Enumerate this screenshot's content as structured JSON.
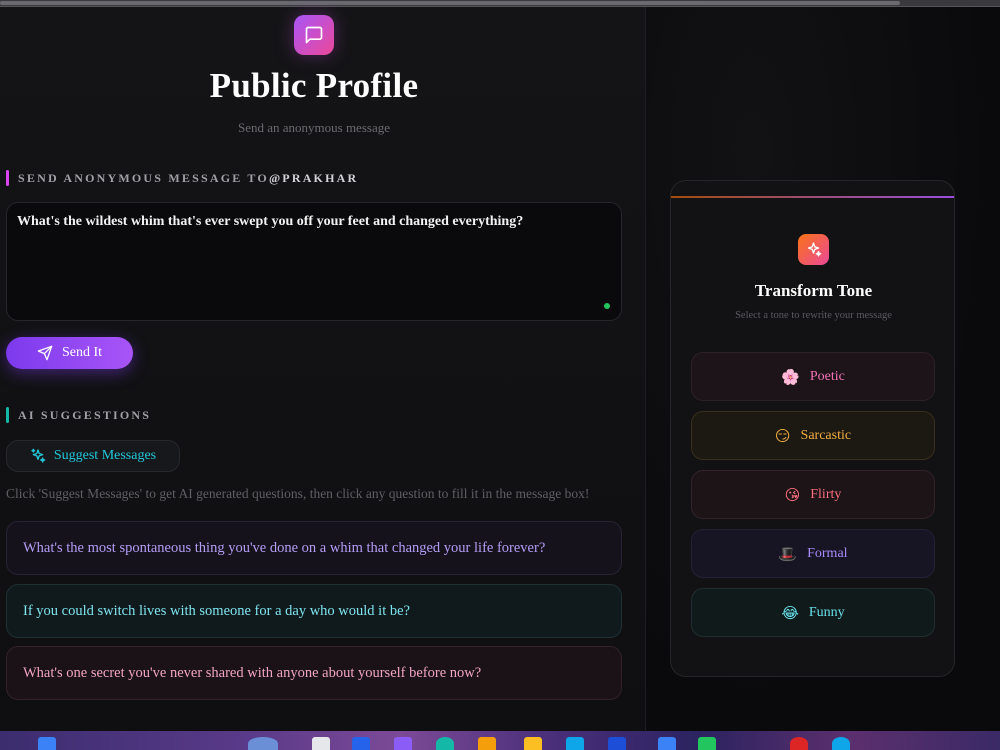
{
  "header": {
    "title": "Public Profile",
    "subtitle": "Send an anonymous message"
  },
  "send_section": {
    "label_prefix": "SEND ANONYMOUS MESSAGE TO ",
    "handle": "@PRAKHAR",
    "message_value": "What's the wildest whim that's ever swept you off your feet and changed everything?",
    "send_label": "Send It"
  },
  "ai_section": {
    "label": "AI SUGGESTIONS",
    "suggest_label": "Suggest Messages",
    "hint": "Click 'Suggest Messages' to get AI generated questions, then click any question to fill it in the message box!",
    "suggestions": [
      "What's the most spontaneous thing you've done on a whim that changed your life forever?",
      "If you could switch lives with someone for a day who would it be?",
      "What's one secret you've never shared with anyone about yourself before now?"
    ]
  },
  "tone_panel": {
    "title": "Transform Tone",
    "subtitle": "Select a tone to rewrite your message",
    "tones": [
      {
        "label": "Poetic",
        "emoji": "🌸",
        "color": "#f472b6"
      },
      {
        "label": "Sarcastic",
        "emoji": "😏",
        "color": "#f5b041"
      },
      {
        "label": "Flirty",
        "emoji": "😘",
        "color": "#fb6f7f"
      },
      {
        "label": "Formal",
        "emoji": "🎩",
        "color": "#a78bfa"
      },
      {
        "label": "Funny",
        "emoji": "😂",
        "color": "#67e0ea"
      }
    ]
  },
  "icons": {
    "logo": "message-square-icon",
    "send": "send-icon",
    "suggest": "sparkles-icon",
    "tone": "sparkles-icon"
  },
  "colors": {
    "primary": "#7c3aed",
    "accent_pink": "#ec4899",
    "cyan": "#22c7d9",
    "status_green": "#22c55e"
  }
}
